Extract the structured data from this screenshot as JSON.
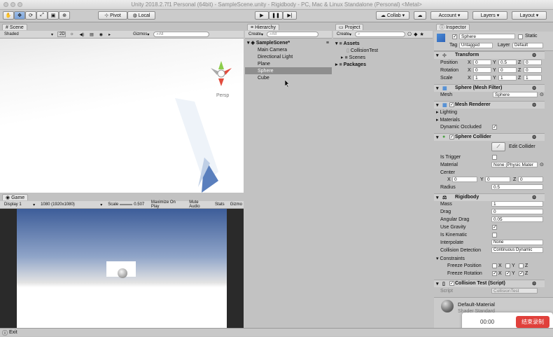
{
  "window": {
    "title": "Unity 2018.2.7f1 Personal (64bit) - SampleScene.unity - Rigidbody - PC, Mac & Linux Standalone (Personal) <Metal>"
  },
  "toolbar": {
    "pivot": "Pivot",
    "local": "Local",
    "collab": "Collab ▾",
    "account": "Account",
    "layers": "Layers",
    "layout": "Layout"
  },
  "scene": {
    "tab": "Scene",
    "shading": "Shaded",
    "mode2d": "2D",
    "gizmos": "Gizmos",
    "search_placeholder": "All",
    "persp": "Persp"
  },
  "game": {
    "tab": "Game",
    "display": "Display 1",
    "resolution": "1080 (1920x1080)",
    "scale_label": "Scale",
    "scale_value": "0.507",
    "maximize": "Maximize On Play",
    "mute": "Mute Audio",
    "stats": "Stats",
    "gizmos": "Gizmo"
  },
  "hierarchy": {
    "tab": "Hierarchy",
    "create": "Create",
    "search_placeholder": "All",
    "scene_name": "SampleScene*",
    "items": [
      "Main Camera",
      "Directional Light",
      "Plane",
      "Sphere",
      "Cube"
    ]
  },
  "project": {
    "tab": "Project",
    "create": "Create",
    "assets": "Assets",
    "assets_children": [
      "CollisionTest",
      "Scenes"
    ],
    "packages": "Packages"
  },
  "inspector": {
    "tab": "Inspector",
    "object_name": "Sphere",
    "static_label": "Static",
    "tag_label": "Tag",
    "tag_value": "Untagged",
    "layer_label": "Layer",
    "layer_value": "Default",
    "transform": {
      "title": "Transform",
      "rows": [
        {
          "label": "Position",
          "x": "0",
          "y": "0.5",
          "z": "0"
        },
        {
          "label": "Rotation",
          "x": "0",
          "y": "0",
          "z": "0"
        },
        {
          "label": "Scale",
          "x": "1",
          "y": "1",
          "z": "1"
        }
      ]
    },
    "mesh_filter": {
      "title": "Sphere (Mesh Filter)",
      "mesh_label": "Mesh",
      "mesh_value": "Sphere"
    },
    "mesh_renderer": {
      "title": "Mesh Renderer",
      "lighting": "Lighting",
      "materials": "Materials",
      "dynamic_occluded": "Dynamic Occluded"
    },
    "collider": {
      "title": "Sphere Collider",
      "edit": "Edit Collider",
      "is_trigger": "Is Trigger",
      "material_label": "Material",
      "material_value": "None (Physic Mater",
      "center_label": "Center",
      "cx": "0",
      "cy": "0",
      "cz": "0",
      "radius_label": "Radius",
      "radius_value": "0.5"
    },
    "rigidbody": {
      "title": "Rigidbody",
      "mass_label": "Mass",
      "mass": "1",
      "drag_label": "Drag",
      "drag": "0",
      "angular_label": "Angular Drag",
      "angular": "0.05",
      "gravity_label": "Use Gravity",
      "kinematic_label": "Is Kinematic",
      "interpolate_label": "Interpolate",
      "interpolate": "None",
      "collision_label": "Collision Detection",
      "collision": "Continuous Dynamic",
      "constraints": "Constraints",
      "freeze_pos": "Freeze Position",
      "freeze_rot": "Freeze Rotation",
      "x": "X",
      "y": "Y",
      "z": "Z"
    },
    "script": {
      "title": "Collision Test (Script)",
      "label": "Script",
      "value": "CollisionTest"
    },
    "material": {
      "title": "Default-Material",
      "shader": "Shader   Standard"
    }
  },
  "status": {
    "text": "Exit"
  },
  "recording": {
    "time": "00:00",
    "stop": "结束录制"
  },
  "colors": {
    "selection": "#8e8e8e",
    "accent": "#3b7bd6",
    "stop_button": "#e0403b"
  }
}
